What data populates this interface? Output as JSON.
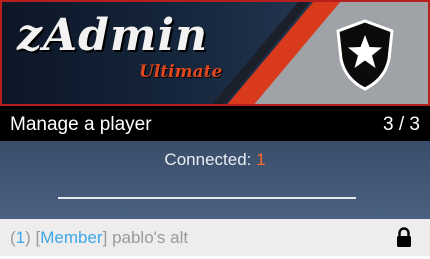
{
  "banner": {
    "logo_text": "zAdmin",
    "logo_sub": "Ultimate",
    "emblem_icon": "shield-star-icon"
  },
  "titlebar": {
    "title": "Manage a player",
    "counter": "3 / 3"
  },
  "description": {
    "connected_label": "Connected: ",
    "connected_count": "1"
  },
  "players": [
    {
      "index_open": "(",
      "index": "1",
      "index_close": ") [",
      "role": "Member",
      "role_close": "] ",
      "name": "pablo's alt",
      "icon": "lock-icon"
    }
  ],
  "colors": {
    "accent_orange": "#ff6a33",
    "accent_blue": "#3ea7e8",
    "banner_border": "#b71e1e"
  }
}
